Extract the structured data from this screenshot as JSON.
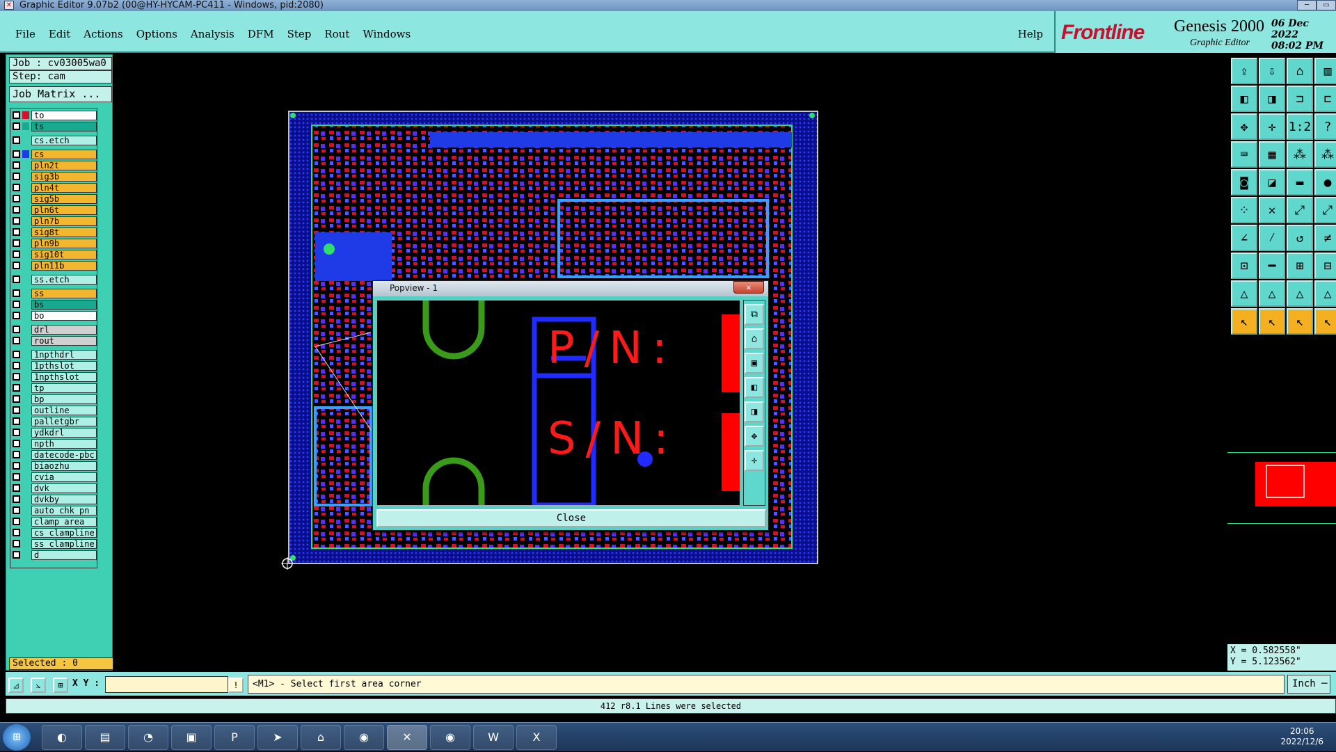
{
  "window": {
    "title": "Graphic Editor 9.07b2 (00@HY-HYCAM-PC411 - Windows, pid:2080)"
  },
  "menu": {
    "items": [
      "File",
      "Edit",
      "Actions",
      "Options",
      "Analysis",
      "DFM",
      "Step",
      "Rout",
      "Windows"
    ],
    "help": "Help"
  },
  "brand": {
    "logo": "Frontline",
    "product": "Genesis 2000",
    "subtitle": "Graphic Editor",
    "date": "06 Dec 2022",
    "time": "08:02 PM"
  },
  "job": {
    "job": "Job : cv03005wa0",
    "step": "Step: cam",
    "matrix": "Job Matrix ..."
  },
  "layers": [
    {
      "name": "to",
      "bg": "#ffffff",
      "sw": "#d6102b"
    },
    {
      "name": "ts",
      "bg": "#19a890",
      "sw": "#19a890"
    },
    {
      "name": "cs.etch",
      "bg": "#aef0e6",
      "sw": "#3fcfb3"
    },
    {
      "name": "cs",
      "bg": "#f3b72f",
      "sw": "#1f3be8"
    },
    {
      "name": "pln2t",
      "bg": "#f3b72f",
      "sw": "#3fcfb3"
    },
    {
      "name": "sig3b",
      "bg": "#f3b72f",
      "sw": "#3fcfb3"
    },
    {
      "name": "pln4t",
      "bg": "#f3b72f",
      "sw": "#3fcfb3"
    },
    {
      "name": "sig5b",
      "bg": "#f3b72f",
      "sw": "#3fcfb3"
    },
    {
      "name": "pln6t",
      "bg": "#f3b72f",
      "sw": "#3fcfb3"
    },
    {
      "name": "pln7b",
      "bg": "#f3b72f",
      "sw": "#3fcfb3"
    },
    {
      "name": "sig8t",
      "bg": "#f3b72f",
      "sw": "#3fcfb3"
    },
    {
      "name": "pln9b",
      "bg": "#f3b72f",
      "sw": "#3fcfb3"
    },
    {
      "name": "sig10t",
      "bg": "#f3b72f",
      "sw": "#3fcfb3"
    },
    {
      "name": "pln11b",
      "bg": "#f3b72f",
      "sw": "#3fcfb3"
    },
    {
      "name": "ss.etch",
      "bg": "#aef0e6",
      "sw": "#3fcfb3"
    },
    {
      "name": "ss",
      "bg": "#f3b72f",
      "sw": "#3fcfb3"
    },
    {
      "name": "bs",
      "bg": "#19a890",
      "sw": "#3fcfb3"
    },
    {
      "name": "bo",
      "bg": "#ffffff",
      "sw": "#3fcfb3"
    },
    {
      "name": "drl",
      "bg": "#d0d0d0",
      "sw": "#3fcfb3"
    },
    {
      "name": "rout",
      "bg": "#d0d0d0",
      "sw": "#3fcfb3"
    },
    {
      "name": "1npthdrl",
      "bg": "#aef0e6",
      "sw": "#3fcfb3"
    },
    {
      "name": "1pthslot",
      "bg": "#aef0e6",
      "sw": "#3fcfb3"
    },
    {
      "name": "1npthslot",
      "bg": "#aef0e6",
      "sw": "#3fcfb3"
    },
    {
      "name": "tp",
      "bg": "#aef0e6",
      "sw": "#3fcfb3"
    },
    {
      "name": "bp",
      "bg": "#aef0e6",
      "sw": "#3fcfb3"
    },
    {
      "name": "outline",
      "bg": "#aef0e6",
      "sw": "#3fcfb3"
    },
    {
      "name": "palletgbr",
      "bg": "#aef0e6",
      "sw": "#3fcfb3"
    },
    {
      "name": "ydkdrl",
      "bg": "#aef0e6",
      "sw": "#3fcfb3"
    },
    {
      "name": "npth",
      "bg": "#aef0e6",
      "sw": "#3fcfb3"
    },
    {
      "name": "datecode-pbc",
      "bg": "#aef0e6",
      "sw": "#3fcfb3"
    },
    {
      "name": "biaozhu",
      "bg": "#aef0e6",
      "sw": "#3fcfb3"
    },
    {
      "name": "cvia",
      "bg": "#aef0e6",
      "sw": "#3fcfb3"
    },
    {
      "name": "dvk",
      "bg": "#aef0e6",
      "sw": "#3fcfb3"
    },
    {
      "name": "dvkby",
      "bg": "#aef0e6",
      "sw": "#3fcfb3"
    },
    {
      "name": "auto_chk_pn",
      "bg": "#aef0e6",
      "sw": "#3fcfb3"
    },
    {
      "name": "clamp_area",
      "bg": "#aef0e6",
      "sw": "#3fcfb3"
    },
    {
      "name": "cs_clampline",
      "bg": "#aef0e6",
      "sw": "#3fcfb3"
    },
    {
      "name": "ss_clampline",
      "bg": "#aef0e6",
      "sw": "#3fcfb3"
    },
    {
      "name": "d",
      "bg": "#aef0e6",
      "sw": "#3fcfb3"
    }
  ],
  "selected": "Selected : 0",
  "popview": {
    "title": "Popview - 1",
    "close": "Close",
    "pn": "P/N:",
    "sn": "S/N:"
  },
  "coords": {
    "x": "X = 0.582558\"",
    "y": "Y = 5.123562\""
  },
  "cmd": {
    "xy_label": "X Y :",
    "prompt": "<M1> - Select first area corner",
    "unit": "Inch ─"
  },
  "status": "412 r8.1 Lines were selected",
  "tray": {
    "time": "20:06",
    "date": "2022/12/6"
  },
  "colors": {
    "panel": "#3fcfb3",
    "board": "#1b1fb0",
    "accent": "#ff0000"
  }
}
